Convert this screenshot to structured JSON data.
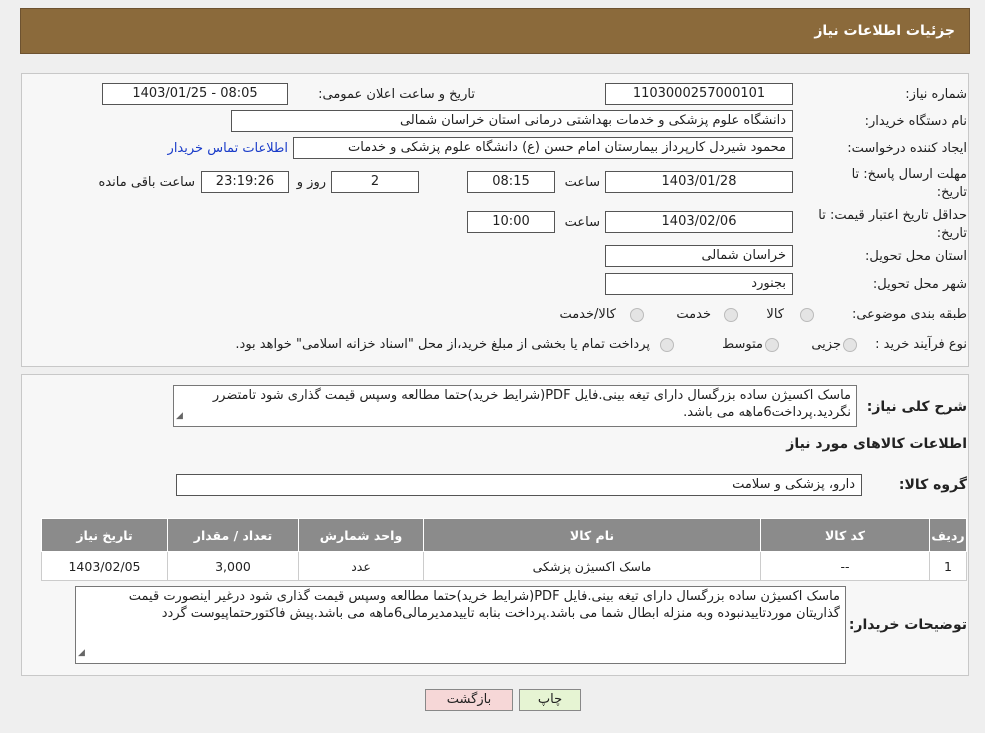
{
  "header": {
    "title": "جزئیات اطلاعات نیاز"
  },
  "form": {
    "need_number": {
      "label": "شماره نیاز:",
      "value": "1103000257000101"
    },
    "announce": {
      "label": "تاریخ و ساعت اعلان عمومی:",
      "value": "1403/01/25 - 08:05"
    },
    "buyer_org": {
      "label": "نام دستگاه خریدار:",
      "value": "دانشگاه علوم پزشکی و خدمات بهداشتی درمانی استان خراسان شمالی"
    },
    "requester": {
      "label": "ایجاد کننده درخواست:",
      "value": "محمود شیردل کارپرداز بیمارستان امام حسن (ع) دانشگاه علوم پزشکی و خدمات",
      "contact_link": "اطلاعات تماس خریدار"
    },
    "deadline": {
      "label": "مهلت ارسال پاسخ: تا تاریخ:",
      "date": "1403/01/28",
      "time_label": "ساعت",
      "time": "08:15",
      "days": "2",
      "days_label": "روز و",
      "remaining": "23:19:26",
      "remaining_label": "ساعت باقی مانده"
    },
    "validity": {
      "label": "حداقل تاریخ اعتبار قیمت: تا تاریخ:",
      "date": "1403/02/06",
      "time_label": "ساعت",
      "time": "10:00"
    },
    "province": {
      "label": "استان محل تحویل:",
      "value": "خراسان شمالی"
    },
    "city": {
      "label": "شهر محل تحویل:",
      "value": "بجنورد"
    },
    "category": {
      "label": "طبقه بندی موضوعی:",
      "options": [
        "کالا",
        "خدمت",
        "کالا/خدمت"
      ]
    },
    "process": {
      "label": "نوع فرآیند خرید :",
      "options": [
        "جزیی",
        "متوسط"
      ],
      "note": "پرداخت تمام یا بخشی از مبلغ خرید،از محل \"اسناد خزانه اسلامی\" خواهد بود."
    }
  },
  "description": {
    "label": "شرح کلی نیاز:",
    "value": "ماسک اکسیژن ساده بزرگسال دارای تیغه بینی.فایل PDF(شرایط خرید)حتما مطالعه وسپس قیمت گذاری شود تامتضرر نگردید.پرداخت6ماهه می باشد."
  },
  "goods": {
    "section_title": "اطلاعات کالاهای مورد نیاز",
    "group_label": "گروه کالا:",
    "group_value": "دارو، پزشکی و سلامت",
    "table": {
      "headers": [
        "ردیف",
        "کد کالا",
        "نام کالا",
        "واحد شمارش",
        "تعداد / مقدار",
        "تاریخ نیاز"
      ],
      "rows": [
        [
          "1",
          "--",
          "ماسک اکسیژن پزشکی",
          "عدد",
          "3,000",
          "1403/02/05"
        ]
      ]
    }
  },
  "buyer_notes": {
    "label": "توضیحات خریدار:",
    "value": "ماسک اکسیژن ساده بزرگسال دارای تیغه بینی.فایل PDF(شرایط خرید)حتما مطالعه وسپس قیمت گذاری شود درغیر اینصورت قیمت گذاریتان موردتاییدنبوده وبه منزله ابطال شما می باشد.پرداخت بنابه تاییدمدیرمالی6ماهه می باشد.پیش فاکتورحتماپیوست گردد"
  },
  "buttons": {
    "print": "چاپ",
    "back": "بازگشت"
  },
  "colors": {
    "header_bg": "#8b6a3b",
    "table_header_bg": "#8b8b8b",
    "back_button_bg": "#f6d7d7",
    "print_button_bg": "#e6f4d3"
  }
}
